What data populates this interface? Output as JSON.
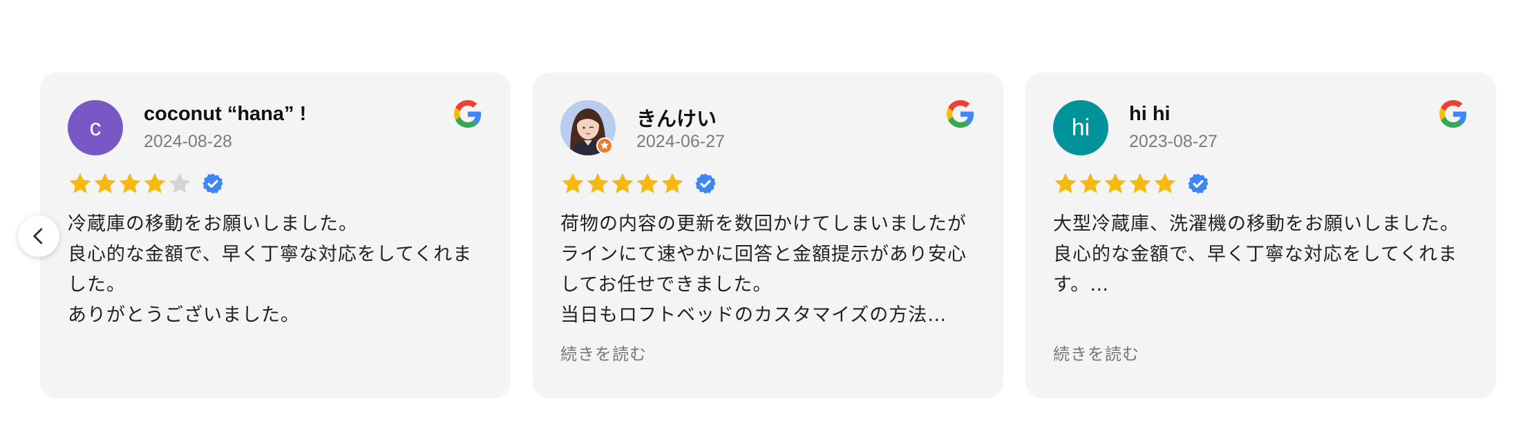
{
  "carousel": {
    "prev_icon": "chevron-left-icon",
    "platform_icon": "google-g-icon",
    "colors": {
      "star_filled": "#F5B90F",
      "star_empty": "#D4D4D4",
      "verified": "#3F86F3",
      "card_bg": "#F4F4F4"
    },
    "reviews": [
      {
        "name": "coconut “hana” !",
        "date": "2024-08-28",
        "avatar_initial": "c",
        "avatar_color": "#7A57C4",
        "rating": 4,
        "text": "冷蔵庫の移動をお願いしました。\n良心的な金額で、早く丁寧な対応をしてくれました。\nありがとうございました。"
      },
      {
        "name": "きんけい",
        "date": "2024-06-27",
        "avatar_initial": "",
        "avatar_color": "#B9CDEF",
        "rating": 5,
        "text": "荷物の内容の更新を数回かけてしまいましたがラインにて速やかに回答と金額提示があり安心してお任せできました。\n当日もロフトベッドのカスタマイズの方法…",
        "read_more": "続きを読む"
      },
      {
        "name": "hi hi",
        "date": "2023-08-27",
        "avatar_initial": "hi",
        "avatar_color": "#00949A",
        "rating": 5,
        "text": "大型冷蔵庫、洗濯機の移動をお願いしました。\n良心的な金額で、早く丁寧な対応をしてくれます。…",
        "read_more": "続きを読む"
      }
    ]
  }
}
